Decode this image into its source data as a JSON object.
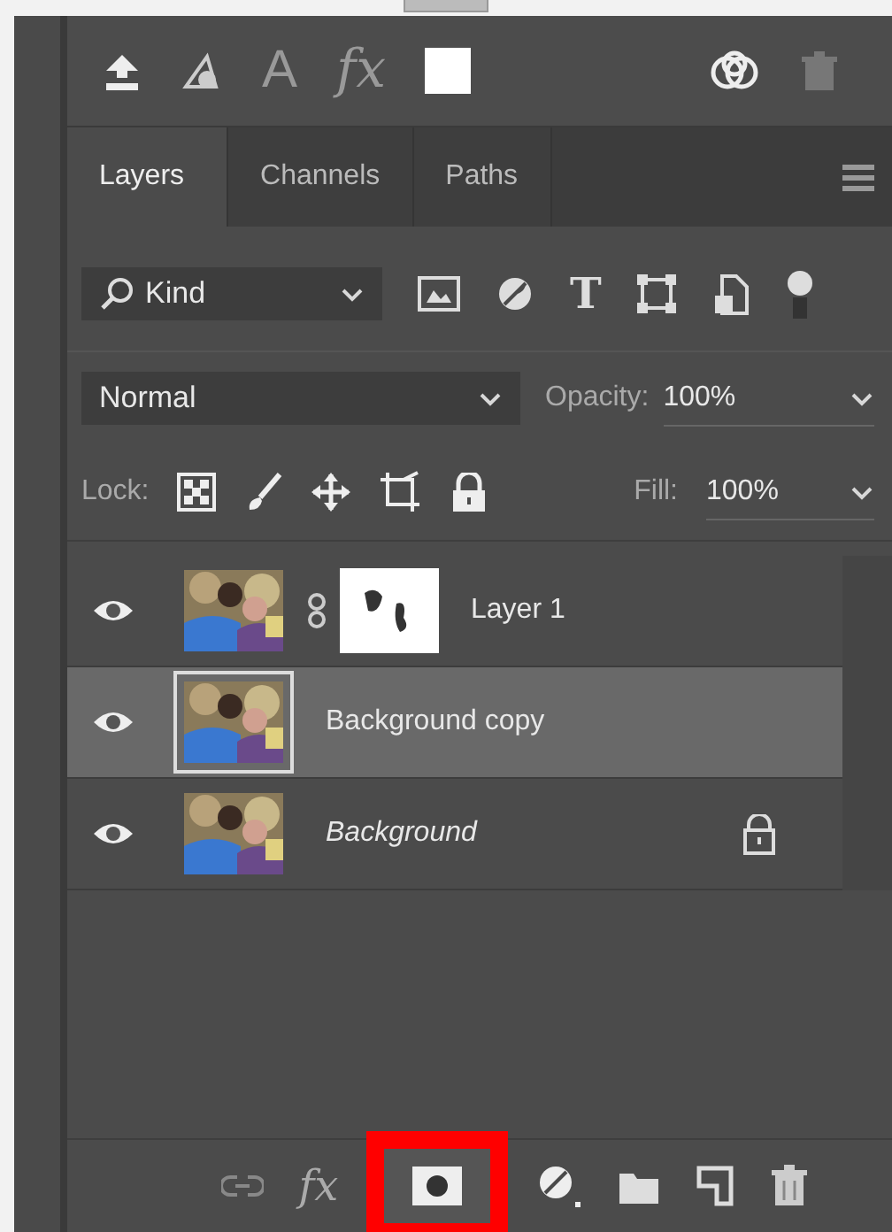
{
  "toolbar": {
    "glyphs": [
      "A",
      "fx"
    ]
  },
  "tabs": [
    {
      "label": "Layers",
      "selected": true
    },
    {
      "label": "Channels",
      "selected": false
    },
    {
      "label": "Paths",
      "selected": false
    }
  ],
  "filter": {
    "value": "Kind",
    "glyph": "T"
  },
  "blend": {
    "mode": "Normal",
    "opacity_label": "Opacity:",
    "opacity": "100%"
  },
  "lock": {
    "label": "Lock:",
    "fill_label": "Fill:",
    "fill": "100%"
  },
  "layers": [
    {
      "name": "Layer 1",
      "kind": "masked",
      "visible": true,
      "selected": false,
      "locked": false
    },
    {
      "name": "Background copy",
      "kind": "normal",
      "visible": true,
      "selected": true,
      "locked": false
    },
    {
      "name": "Background",
      "kind": "background",
      "visible": true,
      "selected": false,
      "locked": true
    }
  ],
  "bottom_bar": {
    "glyph": "fx",
    "mask_highlighted": true
  }
}
